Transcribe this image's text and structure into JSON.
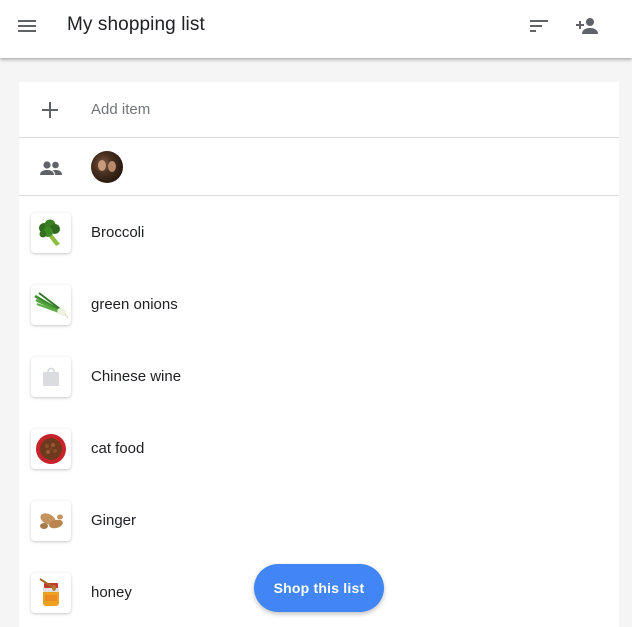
{
  "app": {
    "title": "My shopping list",
    "menu_icon": "menu-icon",
    "sort_icon": "sort-icon",
    "share_icon": "person-add-icon"
  },
  "add_row": {
    "icon": "plus-icon",
    "label": "Add item"
  },
  "people_row": {
    "icon": "people-icon",
    "avatar": "collaborator-avatar"
  },
  "items": [
    {
      "label": "Broccoli",
      "image": "broccoli-image"
    },
    {
      "label": "green onions",
      "image": "green-onions-image"
    },
    {
      "label": "Chinese wine",
      "image": "placeholder-bag-icon"
    },
    {
      "label": "cat food",
      "image": "cat-food-bowl-image"
    },
    {
      "label": "Ginger",
      "image": "ginger-image"
    },
    {
      "label": "honey",
      "image": "honey-jar-image"
    }
  ],
  "fab": {
    "label": "Shop this list"
  },
  "colors": {
    "accent": "#4285f4",
    "text_primary": "#202124",
    "text_secondary": "#70757a",
    "icon": "#5f6368",
    "divider": "#dadce0",
    "background": "#f5f5f5"
  }
}
